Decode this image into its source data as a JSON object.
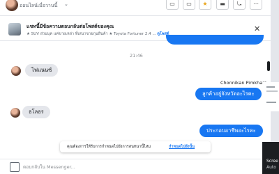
{
  "header": {
    "status_text": "ออนไลน์เมื่อวานนี้",
    "chevron": "⌄",
    "buttons": [
      "▭",
      "▭",
      "★",
      "▬",
      "⤿",
      "⋯"
    ]
  },
  "banner": {
    "title": "แชทนี้มีข้อความตอบกลับต่อโพสต์ของคุณ",
    "subtitle": "★ SUV ส่วนบุค แค่ขายเหล่า ที่เสนาขายกุนสินค้า  ★ Toyota Fortuner 2.4 ...",
    "link": "ดูโพสต์",
    "close": "✕"
  },
  "conversation": {
    "timestamp": "21:46",
    "sender_name": "Chonnikan Pimkham",
    "messages": [
      {
        "direction": "in",
        "text": "ไฟแนนซ์"
      },
      {
        "direction": "out",
        "text": "ลูกค้าอยู่จังหวัดอะไรคะ"
      },
      {
        "direction": "in",
        "text": "ธโลธร"
      },
      {
        "direction": "out",
        "text": "ประกอบอาชีพอะไรคะ"
      }
    ]
  },
  "notice": {
    "text": "คุณต้องการให้รับการกำหนดไปยังการสนทนานี้ไหม",
    "link": "กำหนดไปยังนั้น"
  },
  "compose": {
    "placeholder": "ตอบกลับใน Messenger..."
  },
  "side_panel": {
    "window_label_1": "Scree",
    "window_label_2": "Auto"
  },
  "colors": {
    "accent": "#1877f2",
    "bubble_in": "#e4e6eb",
    "text": "#1c1e21"
  }
}
